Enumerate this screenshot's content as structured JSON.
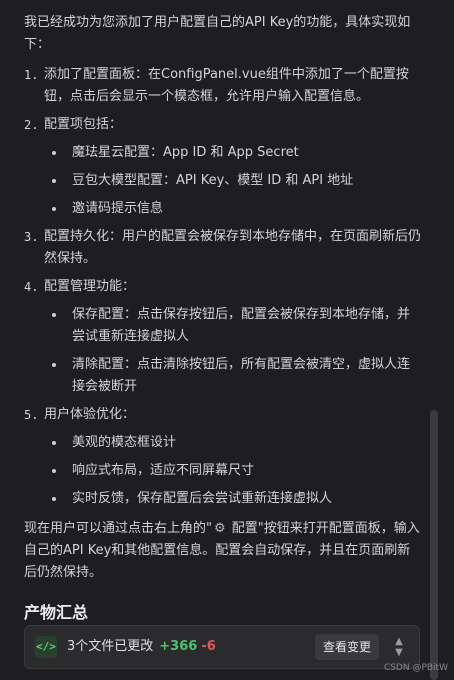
{
  "message": {
    "intro": "我已经成功为您添加了用户配置自己的API Key的功能，具体实现如下：",
    "steps": [
      {
        "num": "1.",
        "text": "添加了配置面板：在ConfigPanel.vue组件中添加了一个配置按钮，点击后会显示一个模态框，允许用户输入配置信息。",
        "items": []
      },
      {
        "num": "2.",
        "text": "配置项包括：",
        "items": [
          "魔珐星云配置：App ID 和 App Secret",
          "豆包大模型配置：API Key、模型 ID 和 API 地址",
          "邀请码提示信息"
        ]
      },
      {
        "num": "3.",
        "text": "配置持久化：用户的配置会被保存到本地存储中，在页面刷新后仍然保持。",
        "items": []
      },
      {
        "num": "4.",
        "text": "配置管理功能：",
        "items": [
          "保存配置：点击保存按钮后，配置会被保存到本地存储，并尝试重新连接虚拟人",
          "清除配置：点击清除按钮后，所有配置会被清空，虚拟人连接会被断开"
        ]
      },
      {
        "num": "5.",
        "text": "用户体验优化：",
        "items": [
          "美观的模态框设计",
          "响应式布局，适应不同屏幕尺寸",
          "实时反馈，保存配置后会尝试重新连接虚拟人"
        ]
      }
    ],
    "outro_before": "现在用户可以通过点击右上角的\"",
    "outro_icon": "gear-icon",
    "outro_after": " 配置\"按钮来打开配置面板，输入自己的API Key和其他配置信息。配置会自动保存，并且在页面刷新后仍然保持。"
  },
  "artifacts": {
    "heading": "产物汇总",
    "changes_label": "3个文件已更改",
    "additions": "+366",
    "deletions": "-6",
    "view_button": "查看变更"
  },
  "watermark": "CSDN @PBitW",
  "colors": {
    "background": "#1e1e20",
    "additions": "#4ec26b",
    "deletions": "#e0575b",
    "code_badge": "#5fd07a"
  }
}
